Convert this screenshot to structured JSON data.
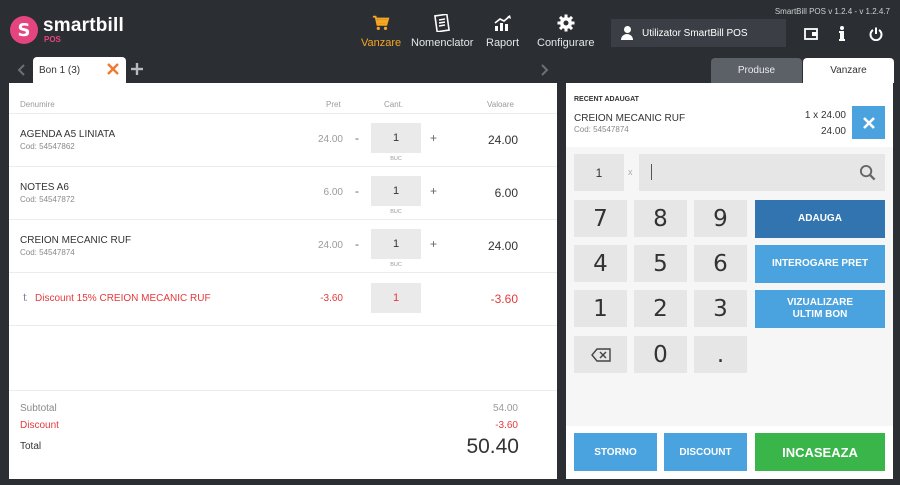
{
  "app": {
    "logo_mark": "S",
    "logo_name": "smartbill",
    "logo_sub": "POS",
    "version": "SmartBill POS  v 1.2.4  -  v 1.2.4.7"
  },
  "nav": [
    {
      "label": "Vanzare",
      "icon": "cart-icon",
      "active": true
    },
    {
      "label": "Nomenclator",
      "icon": "list-icon",
      "active": false
    },
    {
      "label": "Raport",
      "icon": "chart-icon",
      "active": false
    },
    {
      "label": "Configurare",
      "icon": "gear-icon",
      "active": false
    }
  ],
  "user": {
    "name": "Utilizator SmartBill POS"
  },
  "tabs": {
    "receipt": "Bon 1  (3)",
    "side": [
      "Produse",
      "Vanzare"
    ]
  },
  "table": {
    "headers": {
      "name": "Denumire",
      "price": "Pret",
      "qty": "Cant.",
      "value": "Valoare"
    },
    "rows": [
      {
        "name": "AGENDA A5 LINIATA",
        "code": "Cod: 54547862",
        "price": "24.00",
        "qty": "1",
        "unit": "BUC",
        "value": "24.00"
      },
      {
        "name": "NOTES A6",
        "code": "Cod: 54547872",
        "price": "6.00",
        "qty": "1",
        "unit": "BUC",
        "value": "6.00"
      },
      {
        "name": "CREION MECANIC RUF",
        "code": "Cod: 54547874",
        "price": "24.00",
        "qty": "1",
        "unit": "BUC",
        "value": "24.00"
      }
    ],
    "discount_row": {
      "icon": "t",
      "name": "Discount 15% CREION MECANIC RUF",
      "price": "-3.60",
      "qty": "1",
      "value": "-3.60"
    },
    "minus": "-",
    "plus": "+"
  },
  "totals": {
    "subtotal_label": "Subtotal",
    "subtotal_value": "54.00",
    "discount_label": "Discount",
    "discount_value": "-3.60",
    "total_label": "Total",
    "total_value": "50.40"
  },
  "recent": {
    "header": "RECENT ADAUGAT",
    "name": "CREION MECANIC RUF",
    "code": "Cod: 54547874",
    "qty_price": "1 x 24.00",
    "total": "24.00"
  },
  "keypad": {
    "multiplier": "1",
    "x": "x",
    "keys": [
      "7",
      "8",
      "9",
      "4",
      "5",
      "6",
      "1",
      "2",
      "3",
      "0",
      "."
    ],
    "actions": [
      "ADAUGA",
      "INTEROGARE PRET",
      "VIZUALIZARE ULTIM BON"
    ]
  },
  "bottom": {
    "storno": "STORNO",
    "discount": "DISCOUNT",
    "incaseaza": "INCASEAZA"
  },
  "colors": {
    "accent": "#f5a623",
    "brand": "#e5457e",
    "blue": "#4aa3df",
    "dark_blue": "#3274b0",
    "green": "#3ab54a",
    "red": "#e5393d"
  }
}
